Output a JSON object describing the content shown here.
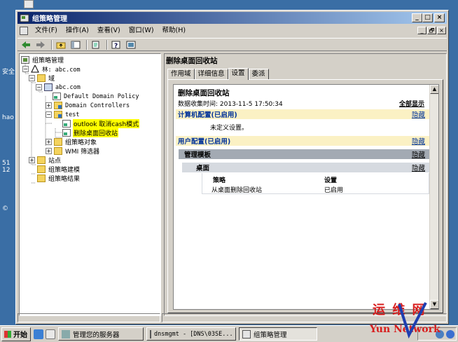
{
  "desktop": {
    "fragments": [
      "安全",
      "hao",
      "51",
      "12",
      "©"
    ]
  },
  "window": {
    "title": "组策略管理",
    "caption_buttons": [
      "_",
      "□",
      "×"
    ],
    "mdi_buttons": [
      "_",
      "🗗",
      "×"
    ]
  },
  "menu": [
    "文件(F)",
    "操作(A)",
    "查看(V)",
    "窗口(W)",
    "帮助(H)"
  ],
  "toolbar_icons": [
    "back-icon",
    "forward-icon",
    "up-folder-icon",
    "show-hide-tree-icon",
    "export-icon",
    "help-icon",
    "properties-icon"
  ],
  "tree": {
    "root": "组策略管理",
    "forest": "林: abc.com",
    "domains": "域",
    "domain": "abc.com",
    "default_policy": "Default Domain Policy",
    "domain_controllers": "Domain Controllers",
    "ou_test": "test",
    "gpo_outlook": "outlook 取消cash模式",
    "gpo_recycle": "删除桌面回收站",
    "gpo_objects": "组策略对象",
    "wmi_filters": "WMI 筛选器",
    "sites": "站点",
    "modeling": "组策略建模",
    "results": "组策略结果"
  },
  "detail": {
    "title": "删除桌面回收站",
    "tabs": [
      "作用域",
      "详细信息",
      "设置",
      "委派"
    ],
    "active_tab": "设置",
    "report": {
      "title": "删除桌面回收站",
      "collected_label": "数据收集时间: 2013-11-5 17:50:34",
      "show_all": "全部显示",
      "computer_config": "计算机配置(已启用)",
      "hide": "隐藏",
      "no_settings": "未定义设置。",
      "user_config": "用户配置(已启用)",
      "admin_templates": "管理模板",
      "desktop": "桌面",
      "col_policy": "策略",
      "col_setting": "设置",
      "row_policy": "从桌面删除回收站",
      "row_setting": "已启用"
    }
  },
  "taskbar": {
    "start": "开始",
    "tasks": [
      "管理您的服务器",
      "dnsmgmt - [DNS\\03SE...",
      "组策略管理"
    ],
    "active_task": "组策略管理"
  },
  "watermark": {
    "line1": "运 维 网",
    "line2": "Yun  Network"
  },
  "colors": {
    "desktop": "#3a6ea5",
    "title_start": "#0a246a",
    "title_end": "#a6caf0",
    "highlight": "#ffff00",
    "section_yellow": "#fbf1c4",
    "link_blue": "#003399",
    "watermark_red": "#d81e1e",
    "watermark_blue": "#1f3fb0"
  }
}
